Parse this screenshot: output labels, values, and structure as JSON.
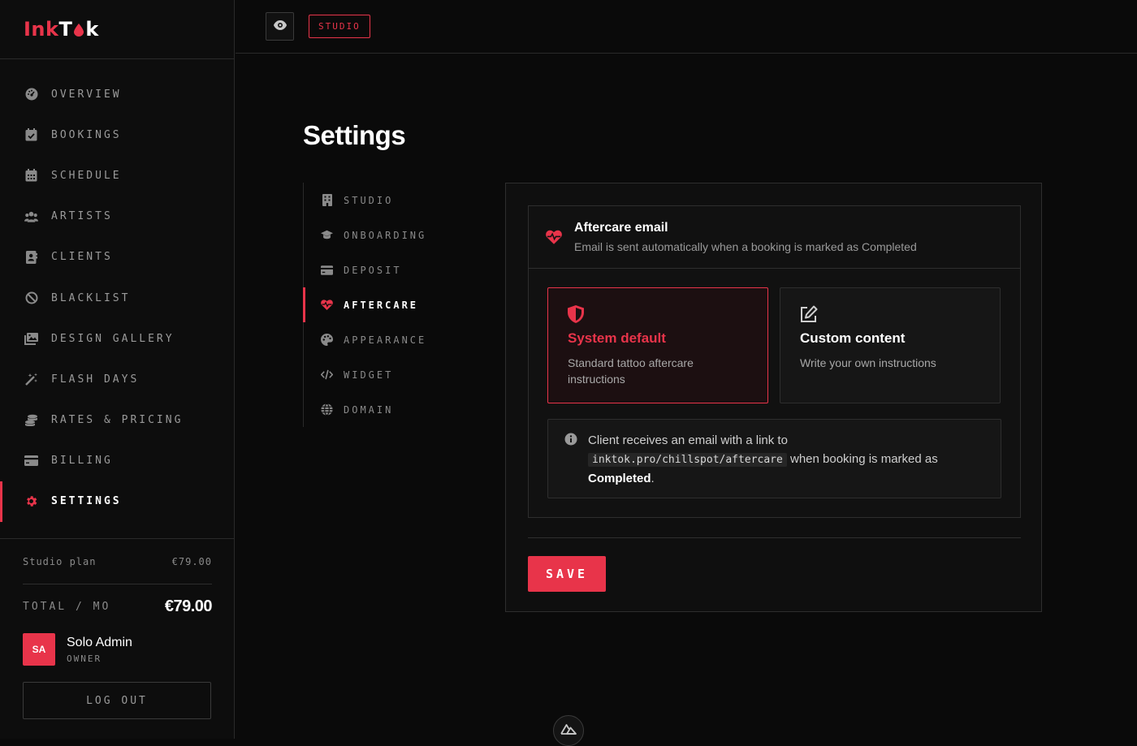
{
  "brand": {
    "part1": "Ink",
    "part2": "T",
    "part3": "k",
    "accent": "#e8344a"
  },
  "sidebar": {
    "items": [
      {
        "label": "OVERVIEW",
        "icon": "gauge-icon"
      },
      {
        "label": "BOOKINGS",
        "icon": "calendar-check-icon"
      },
      {
        "label": "SCHEDULE",
        "icon": "calendar-icon"
      },
      {
        "label": "ARTISTS",
        "icon": "users-icon"
      },
      {
        "label": "CLIENTS",
        "icon": "contact-book-icon"
      },
      {
        "label": "BLACKLIST",
        "icon": "ban-icon"
      },
      {
        "label": "DESIGN GALLERY",
        "icon": "images-icon"
      },
      {
        "label": "FLASH DAYS",
        "icon": "magic-wand-icon"
      },
      {
        "label": "RATES & PRICING",
        "icon": "coins-icon"
      },
      {
        "label": "BILLING",
        "icon": "credit-card-icon"
      },
      {
        "label": "SETTINGS",
        "icon": "gear-icon",
        "active": true
      }
    ],
    "plan": {
      "label": "Studio plan",
      "price": "€79.00"
    },
    "total": {
      "label": "TOTAL / MO",
      "value": "€79.00"
    },
    "user": {
      "initials": "SA",
      "name": "Solo Admin",
      "role": "OWNER"
    },
    "logout_label": "LOG OUT"
  },
  "topbar": {
    "badge": "STUDIO"
  },
  "main": {
    "title": "Settings",
    "subnav": [
      {
        "label": "STUDIO",
        "icon": "building-icon"
      },
      {
        "label": "ONBOARDING",
        "icon": "graduation-cap-icon"
      },
      {
        "label": "DEPOSIT",
        "icon": "credit-card-icon"
      },
      {
        "label": "AFTERCARE",
        "icon": "heart-pulse-icon",
        "active": true
      },
      {
        "label": "APPEARANCE",
        "icon": "palette-icon"
      },
      {
        "label": "WIDGET",
        "icon": "code-icon"
      },
      {
        "label": "DOMAIN",
        "icon": "globe-icon"
      }
    ],
    "aftercare": {
      "title": "Aftercare email",
      "subtitle": "Email is sent automatically when a booking is marked as Completed",
      "options": [
        {
          "title": "System default",
          "desc": "Standard tattoo aftercare instructions",
          "icon": "shield-icon",
          "selected": true
        },
        {
          "title": "Custom content",
          "desc": "Write your own instructions",
          "icon": "edit-icon",
          "selected": false
        }
      ],
      "info": {
        "pre": "Client receives an email with a link to",
        "link": "inktok.pro/chillspot/aftercare",
        "mid": "when booking is marked as",
        "strong": "Completed",
        "end": "."
      }
    },
    "save_label": "SAVE"
  }
}
